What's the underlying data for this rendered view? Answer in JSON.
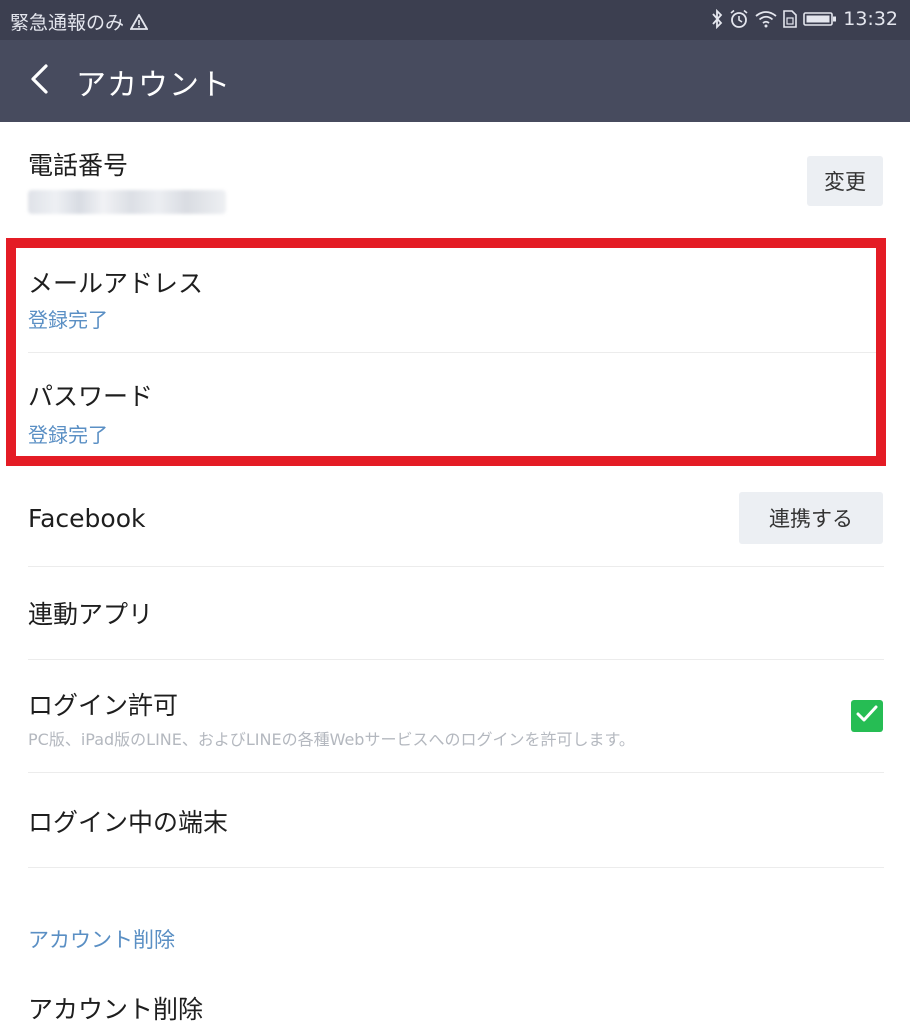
{
  "status_bar": {
    "left_text": "緊急通報のみ",
    "time": "13:32"
  },
  "header": {
    "title": "アカウント"
  },
  "phone": {
    "label": "電話番号",
    "change_button": "変更"
  },
  "email": {
    "label": "メールアドレス",
    "status": "登録完了"
  },
  "password": {
    "label": "パスワード",
    "status": "登録完了"
  },
  "facebook": {
    "label": "Facebook",
    "link_button": "連携する"
  },
  "linked_apps": {
    "label": "連動アプリ"
  },
  "login_permission": {
    "label": "ログイン許可",
    "description": "PC版、iPad版のLINE、およびLINEの各種Webサービスへのログインを許可します。",
    "checked": true
  },
  "logged_in_devices": {
    "label": "ログイン中の端末"
  },
  "delete_section": {
    "title": "アカウント削除",
    "item_label": "アカウント削除"
  },
  "colors": {
    "header_bg": "#474b5e",
    "status_bg": "#3c3f50",
    "link_blue": "#5a8fc4",
    "highlight_red": "#e41c25",
    "check_green": "#26bd54"
  },
  "icons": [
    "warning-icon",
    "bluetooth-icon",
    "alarm-icon",
    "wifi-icon",
    "sim-icon",
    "battery-icon",
    "back-arrow-icon",
    "check-icon"
  ]
}
